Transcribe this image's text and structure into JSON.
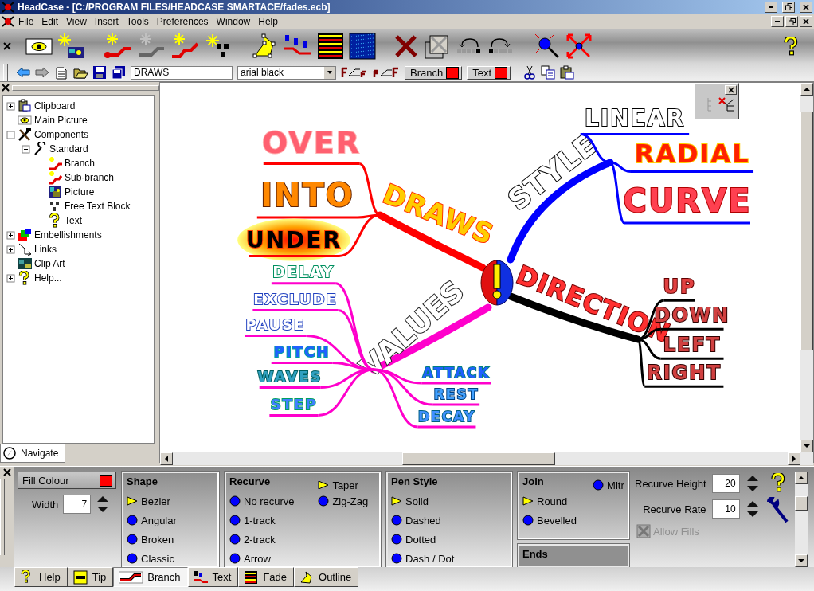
{
  "window": {
    "title": "HeadCase - [C:/PROGRAM FILES/HEADCASE SMARTACE/fades.ecb]"
  },
  "menu": [
    "File",
    "Edit",
    "View",
    "Insert",
    "Tools",
    "Preferences",
    "Window",
    "Help"
  ],
  "text_toolbar": {
    "text_value": "DRAWS",
    "font": "arial black",
    "color_buttons": [
      {
        "label": "Branch",
        "color": "#ff0000"
      },
      {
        "label": "Text",
        "color": "#ff0000"
      }
    ]
  },
  "navigator": {
    "tree": [
      {
        "label": "Clipboard",
        "expanded": false
      },
      {
        "label": "Main Picture"
      },
      {
        "label": "Components",
        "expanded": true,
        "children": [
          {
            "label": "Standard",
            "expanded": true,
            "children": [
              {
                "label": "Branch"
              },
              {
                "label": "Sub-branch"
              },
              {
                "label": "Picture"
              },
              {
                "label": "Free Text Block"
              },
              {
                "label": "Text"
              }
            ]
          }
        ]
      },
      {
        "label": "Embellishments",
        "expanded": false
      },
      {
        "label": "Links",
        "expanded": false
      },
      {
        "label": "Clip Art"
      },
      {
        "label": "Help...",
        "expanded": false
      }
    ],
    "tab": "Navigate"
  },
  "mind_map": {
    "branches": [
      {
        "label": "DRAWS",
        "color": "#ff0000",
        "children": [
          {
            "label": "OVER"
          },
          {
            "label": "INTO"
          },
          {
            "label": "UNDER"
          }
        ]
      },
      {
        "label": "STYLE",
        "color": "#0000ff",
        "children": [
          {
            "label": "LINEAR"
          },
          {
            "label": "RADIAL"
          },
          {
            "label": "CURVE"
          }
        ]
      },
      {
        "label": "DIRECTION",
        "color": "#000000",
        "children": [
          {
            "label": "UP"
          },
          {
            "label": "DOWN"
          },
          {
            "label": "LEFT"
          },
          {
            "label": "RIGHT"
          }
        ]
      },
      {
        "label": "VALUES",
        "color": "#ff00cc",
        "children": [
          {
            "label": "DELAY"
          },
          {
            "label": "EXCLUDE"
          },
          {
            "label": "PAUSE"
          },
          {
            "label": "PITCH"
          },
          {
            "label": "WAVES"
          },
          {
            "label": "STEP"
          },
          {
            "label": "ATTACK"
          },
          {
            "label": "REST"
          },
          {
            "label": "DECAY"
          }
        ]
      }
    ]
  },
  "properties": {
    "fill_colour": {
      "label": "Fill Colour",
      "color": "#ff0000"
    },
    "width": {
      "label": "Width",
      "value": "7"
    },
    "groups": [
      {
        "title": "Shape",
        "options": [
          {
            "label": "Bezier",
            "selected": true
          },
          {
            "label": "Angular",
            "selected": false
          },
          {
            "label": "Broken",
            "selected": false
          },
          {
            "label": "Classic",
            "selected": false
          }
        ]
      },
      {
        "title": "Recurve",
        "options": [
          {
            "label": "No recurve",
            "selected": false
          },
          {
            "label": "1-track",
            "selected": false
          },
          {
            "label": "2-track",
            "selected": false
          },
          {
            "label": "Arrow",
            "selected": false
          },
          {
            "label": "Taper",
            "selected": true
          },
          {
            "label": "Zig-Zag",
            "selected": false
          }
        ]
      },
      {
        "title": "Pen Style",
        "options": [
          {
            "label": "Solid",
            "selected": true
          },
          {
            "label": "Dashed",
            "selected": false
          },
          {
            "label": "Dotted",
            "selected": false
          },
          {
            "label": "Dash / Dot",
            "selected": false
          }
        ]
      },
      {
        "title": "Join",
        "options": [
          {
            "label": "Round",
            "selected": true
          },
          {
            "label": "Bevelled",
            "selected": false
          },
          {
            "label": "Mitr",
            "selected": false
          }
        ]
      }
    ],
    "ends": {
      "title": "Ends"
    },
    "spinners": [
      {
        "label": "Recurve Height",
        "value": "20"
      },
      {
        "label": "Recurve Rate",
        "value": "10"
      }
    ],
    "allow_fills": {
      "label": "Allow Fills",
      "disabled": true
    }
  },
  "bottom_tabs": [
    {
      "label": "Help",
      "selected": false
    },
    {
      "label": "Tip",
      "selected": false
    },
    {
      "label": "Branch",
      "selected": true
    },
    {
      "label": "Text",
      "selected": false
    },
    {
      "label": "Fade",
      "selected": false
    },
    {
      "label": "Outline",
      "selected": false
    }
  ]
}
